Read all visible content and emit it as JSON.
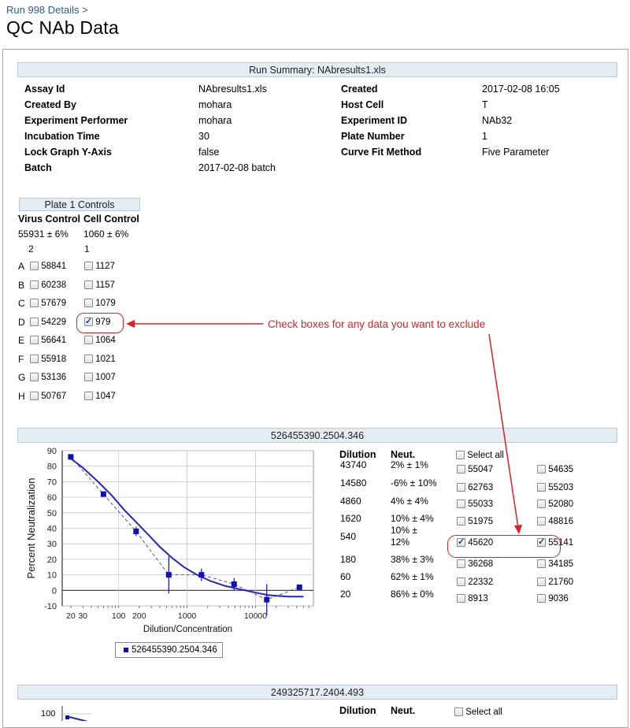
{
  "breadcrumb": {
    "link": "Run 998 Details",
    "sep": ">"
  },
  "title": "QC NAb Data",
  "run_summary": {
    "header": "Run Summary: NAbresults1.xls",
    "left": [
      {
        "k": "Assay Id",
        "v": "NAbresults1.xls"
      },
      {
        "k": "Created By",
        "v": "mohara"
      },
      {
        "k": "Experiment Performer",
        "v": "mohara"
      },
      {
        "k": "Incubation Time",
        "v": "30"
      },
      {
        "k": "Lock Graph Y-Axis",
        "v": "false"
      },
      {
        "k": "Batch",
        "v": "2017-02-08 batch"
      }
    ],
    "right": [
      {
        "k": "Created",
        "v": "2017-02-08 16:05"
      },
      {
        "k": "Host Cell",
        "v": "T"
      },
      {
        "k": "Experiment ID",
        "v": "NAb32"
      },
      {
        "k": "Plate Number",
        "v": "1"
      },
      {
        "k": "Curve Fit Method",
        "v": "Five Parameter"
      }
    ]
  },
  "plate_controls": {
    "header": "Plate 1 Controls",
    "virus_label": "Virus Control",
    "cell_label": "Cell Control",
    "virus_mean": "55931 ± 6%",
    "cell_mean": "1060 ± 6%",
    "virus_col": "2",
    "cell_col": "1",
    "rows": [
      {
        "r": "A",
        "v": "58841",
        "c": "1127",
        "cchk": false
      },
      {
        "r": "B",
        "v": "60238",
        "c": "1157",
        "cchk": false
      },
      {
        "r": "C",
        "v": "57679",
        "c": "1079",
        "cchk": false
      },
      {
        "r": "D",
        "v": "54229",
        "c": "979",
        "cchk": true
      },
      {
        "r": "E",
        "v": "56641",
        "c": "1064",
        "cchk": false
      },
      {
        "r": "F",
        "v": "55918",
        "c": "1021",
        "cchk": false
      },
      {
        "r": "G",
        "v": "53136",
        "c": "1007",
        "cchk": false
      },
      {
        "r": "H",
        "v": "50767",
        "c": "1047",
        "cchk": false
      }
    ]
  },
  "annotation": "Check boxes for any data you want to exclude",
  "sample1": {
    "header": "526455390.2504.346",
    "dil_label": "Dilution",
    "neut_label": "Neut.",
    "select_all": "Select all",
    "rows": [
      {
        "d": "43740",
        "n": "2% ± 1%",
        "w1": "55047",
        "w1c": false,
        "w2": "54635",
        "w2c": false
      },
      {
        "d": "14580",
        "n": "-6% ± 10%",
        "w1": "62763",
        "w1c": false,
        "w2": "55203",
        "w2c": false
      },
      {
        "d": "4860",
        "n": "4% ± 4%",
        "w1": "55033",
        "w1c": false,
        "w2": "52080",
        "w2c": false
      },
      {
        "d": "1620",
        "n": "10% ± 4%",
        "w1": "51975",
        "w1c": false,
        "w2": "48816",
        "w2c": false
      },
      {
        "d": "540",
        "n": "10% ±",
        "n2": "12%",
        "w1": "45620",
        "w1c": true,
        "w2": "55141",
        "w2c": true
      },
      {
        "d": "180",
        "n": "38% ± 3%",
        "w1": "36268",
        "w1c": false,
        "w2": "34185",
        "w2c": false
      },
      {
        "d": "60",
        "n": "62% ± 1%",
        "w1": "22332",
        "w1c": false,
        "w2": "21760",
        "w2c": false
      },
      {
        "d": "20",
        "n": "86% ± 0%",
        "w1": "8913",
        "w1c": false,
        "w2": "9036",
        "w2c": false
      }
    ],
    "legend": "526455390.2504.346"
  },
  "sample2": {
    "header": "249325717.2404.493",
    "dil_label": "Dilution",
    "neut_label": "Neut.",
    "select_all": "Select all",
    "y_top_tick": "100"
  },
  "chart_data": {
    "type": "scatter",
    "title": "",
    "xlabel": "Dilution/Concentration",
    "ylabel": "Percent Neutralization",
    "x_scale": "log",
    "xlim": [
      15,
      70000
    ],
    "ylim": [
      -10,
      90
    ],
    "x_tick_labels": [
      "20",
      "30",
      "100",
      "200",
      "1000",
      "10000"
    ],
    "y_tick_labels": [
      "90",
      "80",
      "70",
      "60",
      "50",
      "40",
      "30",
      "20",
      "10",
      "0",
      "-10"
    ],
    "series": [
      {
        "name": "526455390.2504.346",
        "x": [
          20,
          60,
          180,
          540,
          1620,
          4860,
          14580,
          43740
        ],
        "y": [
          86,
          62,
          38,
          10,
          10,
          4,
          -6,
          2
        ],
        "err": [
          0,
          1,
          3,
          12,
          4,
          4,
          10,
          1
        ]
      }
    ],
    "fit_curve": {
      "x": [
        20,
        30,
        50,
        80,
        120,
        180,
        270,
        400,
        600,
        900,
        1400,
        2200,
        3500,
        5500,
        9000,
        15000,
        30000,
        50000
      ],
      "y": [
        85,
        79,
        70,
        61,
        52,
        44,
        36,
        28,
        21,
        15,
        10,
        6,
        3,
        1,
        -1,
        -3,
        -4,
        -4
      ]
    },
    "grid": true,
    "legend": "bottom"
  }
}
